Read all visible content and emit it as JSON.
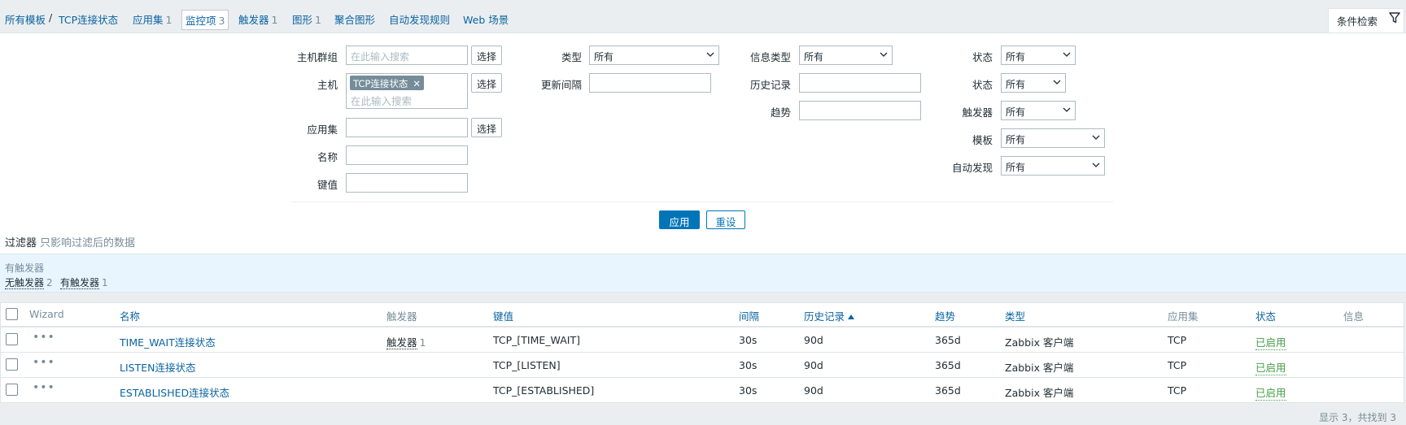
{
  "nav": {
    "all_templates": "所有模板",
    "separator": "/",
    "template_name": "TCP连接状态",
    "applications": {
      "label": "应用集",
      "count": "1"
    },
    "items": {
      "label": "监控项",
      "count": "3"
    },
    "triggers": {
      "label": "触发器",
      "count": "1"
    },
    "graphs": {
      "label": "图形",
      "count": "1"
    },
    "screens": "聚合图形",
    "discovery": "自动发现规则",
    "web": "Web 场景"
  },
  "filter_tab": {
    "label": "条件检索",
    "icon": "funnel-icon"
  },
  "filter": {
    "host_group": {
      "label": "主机群组",
      "placeholder": "在此输入搜索",
      "button": "选择"
    },
    "host": {
      "label": "主机",
      "tag": "TCP连接状态",
      "placeholder": "在此输入搜索",
      "button": "选择"
    },
    "application": {
      "label": "应用集",
      "value": "",
      "button": "选择"
    },
    "name": {
      "label": "名称",
      "value": ""
    },
    "key": {
      "label": "键值",
      "value": ""
    },
    "type": {
      "label": "类型",
      "value": "所有"
    },
    "update_interval": {
      "label": "更新间隔",
      "value": ""
    },
    "info_type": {
      "label": "信息类型",
      "value": "所有"
    },
    "history": {
      "label": "历史记录",
      "value": ""
    },
    "trends": {
      "label": "趋势",
      "value": ""
    },
    "state": {
      "label": "状态",
      "value": "所有"
    },
    "status": {
      "label": "状态",
      "value": "所有"
    },
    "triggers": {
      "label": "触发器",
      "value": "所有"
    },
    "template": {
      "label": "模板",
      "value": "所有"
    },
    "discovered": {
      "label": "自动发现",
      "value": "所有"
    },
    "apply": "应用",
    "reset": "重设",
    "note": "过滤器",
    "note_sub": "只影响过滤后的数据"
  },
  "subfilter": {
    "title": "有触发器",
    "options": [
      {
        "label": "无触发器",
        "count": "2"
      },
      {
        "label": "有触发器",
        "count": "1"
      }
    ]
  },
  "table": {
    "headers": {
      "wizard": "Wizard",
      "name": "名称",
      "triggers": "触发器",
      "key": "键值",
      "interval": "间隔",
      "history": "历史记录",
      "trends": "趋势",
      "type": "类型",
      "applications": "应用集",
      "status": "状态",
      "info": "信息"
    },
    "rows": [
      {
        "name": "TIME_WAIT连接状态",
        "triggers_label": "触发器",
        "triggers_count": "1",
        "key": "TCP_[TIME_WAIT]",
        "interval": "30s",
        "history": "90d",
        "trends": "365d",
        "type": "Zabbix 客户端",
        "applications": "TCP",
        "status": "已启用"
      },
      {
        "name": "LISTEN连接状态",
        "triggers_label": "",
        "triggers_count": "",
        "key": "TCP_[LISTEN]",
        "interval": "30s",
        "history": "90d",
        "trends": "365d",
        "type": "Zabbix 客户端",
        "applications": "TCP",
        "status": "已启用"
      },
      {
        "name": "ESTABLISHED连接状态",
        "triggers_label": "",
        "triggers_count": "",
        "key": "TCP_[ESTABLISHED]",
        "interval": "30s",
        "history": "90d",
        "trends": "365d",
        "type": "Zabbix 客户端",
        "applications": "TCP",
        "status": "已启用"
      }
    ]
  },
  "footer": "显示 3，共找到 3"
}
